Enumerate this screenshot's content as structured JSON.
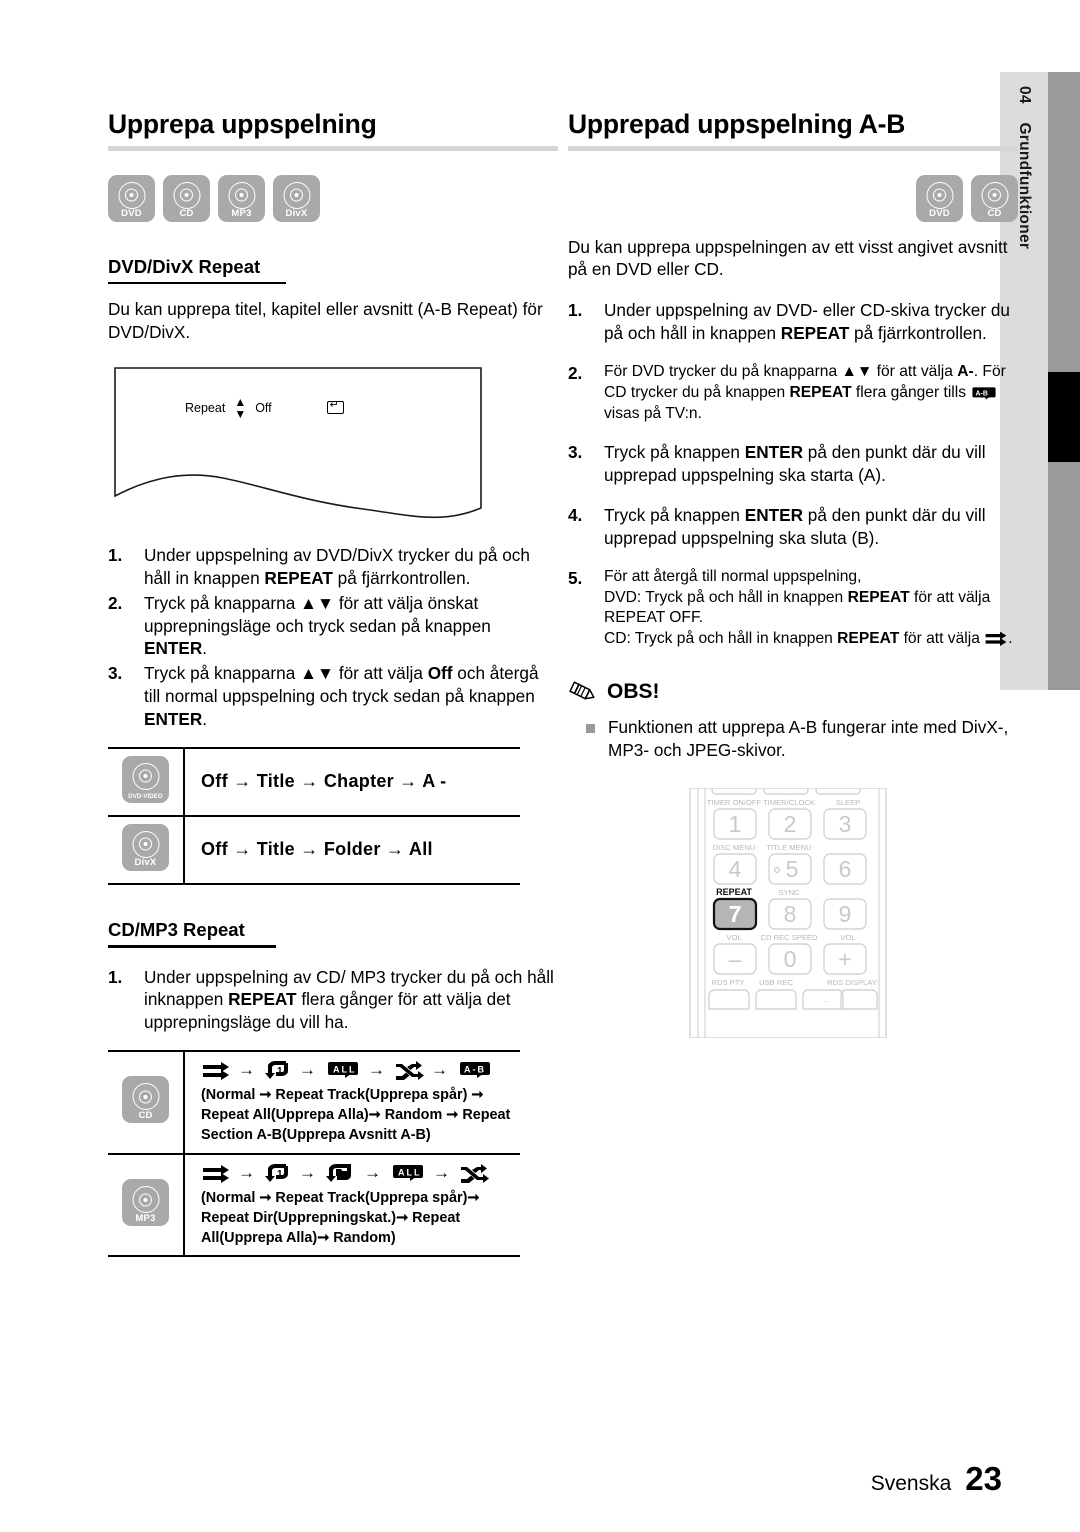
{
  "side_tab": {
    "number": "04",
    "label": "Grundfunktioner"
  },
  "footer": {
    "language": "Svenska",
    "page": "23"
  },
  "left": {
    "title": "Upprepa uppspelning",
    "discs": [
      {
        "name": "dvd-disc-icon",
        "label": "DVD"
      },
      {
        "name": "cd-disc-icon",
        "label": "CD"
      },
      {
        "name": "mp3-disc-icon",
        "label": "MP3"
      },
      {
        "name": "divx-disc-icon",
        "label": "DivX"
      }
    ],
    "subtitle": "DVD/DivX Repeat",
    "intro": "Du kan upprepa titel, kapitel eller avsnitt (A-B Repeat) för DVD/DivX.",
    "osd": {
      "label": "Repeat",
      "value": "Off",
      "updown_icon": "up-down-arrow-icon",
      "return_icon": "return-icon"
    },
    "steps": [
      {
        "n": "1.",
        "text": "Under uppspelning av DVD/DivX trycker du på och håll in knappen ",
        "bold": "REPEAT",
        "text2": " på fjärrkontrollen."
      },
      {
        "n": "2.",
        "text": "Tryck på knapparna ▲▼ för att välja önskat upprepningsläge och tryck sedan på knappen ",
        "bold": "ENTER",
        "text2": "."
      },
      {
        "n": "3.",
        "text": "Tryck på knapparna ▲▼ för att välja ",
        "bold": "Off",
        "text2": " och återgå till normal uppspelning och tryck sedan på knappen ",
        "bold2": "ENTER",
        "text3": "."
      }
    ],
    "mode_table": [
      {
        "icon": "dvd-video-disc-icon",
        "icon_label": "DVD-VIDEO",
        "sequence": "Off → Title → Chapter → A -"
      },
      {
        "icon": "divx-disc-icon",
        "icon_label": "DivX",
        "sequence": "Off → Title → Folder → All"
      }
    ],
    "subtitle2": "CD/MP3 Repeat",
    "steps2": [
      {
        "n": "1.",
        "text": "Under uppspelning av CD/ MP3 trycker du på och håll inknappen ",
        "bold": "REPEAT",
        "text2": " flera gånger för att välja det upprepningsläge du vill ha."
      }
    ],
    "glyph_table": [
      {
        "icon": "cd-disc-icon",
        "icon_label": "CD",
        "glyphs": [
          "normal-icon",
          "repeat-one-icon",
          "repeat-all-icon",
          "random-icon",
          "repeat-ab-icon"
        ],
        "note": "(Normal ➞ Repeat Track(Upprepa spår) ➞ Repeat All(Upprepa Alla)➞ Random ➞ Repeat Section A-B(Upprepa Avsnitt A-B)"
      },
      {
        "icon": "mp3-disc-icon",
        "icon_label": "MP3",
        "glyphs": [
          "normal-icon",
          "repeat-one-icon",
          "repeat-dir-icon",
          "repeat-all-icon",
          "random-icon"
        ],
        "note": "(Normal  ➞ Repeat Track(Upprepa spår)➞ Repeat Dir(Upprepningskat.)➞ Repeat All(Upprepa Alla)➞ Random)"
      }
    ]
  },
  "right": {
    "title": "Upprepad uppspelning A-B",
    "discs": [
      {
        "name": "dvd-disc-icon",
        "label": "DVD"
      },
      {
        "name": "cd-disc-icon",
        "label": "CD"
      }
    ],
    "intro": "Du kan upprepa uppspelningen av ett visst angivet avsnitt på en DVD eller CD.",
    "steps": [
      {
        "n": "1.",
        "p1": "Under uppspelning av DVD- eller CD-skiva trycker du på och håll in knappen ",
        "b1": "REPEAT",
        "p2": " på fjärrkontrollen."
      },
      {
        "n": "2.",
        "p1": "För DVD trycker du på knapparna ▲▼ för att välja ",
        "b1": "A-",
        "p2": ". För CD trycker du på knappen ",
        "b2": "REPEAT",
        "p3": " flera gånger tills ",
        "glyph": "repeat-ab-icon",
        "p4": " visas på TV:n."
      },
      {
        "n": "3.",
        "p1": "Tryck på knappen ",
        "b1": "ENTER",
        "p2": " på den punkt där du vill upprepad uppspelning ska starta (A)."
      },
      {
        "n": "4.",
        "p1": "Tryck på knappen ",
        "b1": "ENTER",
        "p2": " på den punkt där du vill upprepad uppspelning ska sluta (B)."
      },
      {
        "n": "5.",
        "p1": "För att återgå till normal uppspelning,",
        "p2": "DVD: Tryck på och håll in knappen ",
        "b1": "REPEAT",
        "p3": " för att välja REPEAT OFF.",
        "p4": "CD: Tryck på och håll in knappen ",
        "b2": "REPEAT",
        "p5": " för att välja ",
        "glyph": "normal-icon",
        "p6": "."
      }
    ],
    "note": {
      "icon": "pencil-icon",
      "heading": "OBS!",
      "items": [
        "Funktionen att upprepa A-B fungerar inte med DivX-, MP3- och JPEG-skivor."
      ]
    },
    "remote": {
      "name": "remote-control-illustration",
      "highlight_key": "7",
      "highlight_label": "REPEAT",
      "rows": [
        {
          "labels": [
            "TIMER ON/OFF",
            "TIMER/CLOCK",
            "SLEEP"
          ],
          "keys": [
            "1",
            "2",
            "3"
          ]
        },
        {
          "labels": [
            "DISC MENU",
            "TITLE MENU",
            ""
          ],
          "keys": [
            "4",
            "5",
            "6"
          ]
        },
        {
          "labels": [
            "REPEAT",
            "SYNC",
            ""
          ],
          "keys": [
            "7",
            "8",
            "9"
          ]
        },
        {
          "labels": [
            "VOL",
            "CD REC SPEED",
            "VOL"
          ],
          "keys": [
            "–",
            "0",
            "+"
          ]
        },
        {
          "labels": [
            "RDS PTY",
            "USB REC",
            "RDS DISPLAY"
          ],
          "keys": [
            "",
            "",
            ""
          ]
        }
      ]
    }
  }
}
